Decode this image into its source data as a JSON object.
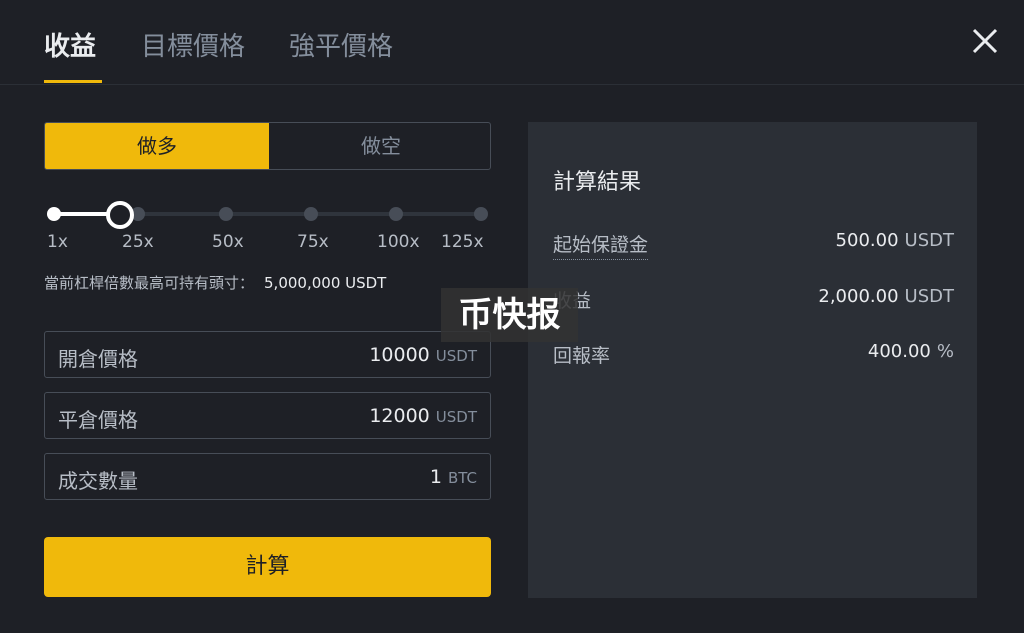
{
  "tabs": [
    {
      "label": "收益",
      "active": true
    },
    {
      "label": "目標價格",
      "active": false
    },
    {
      "label": "強平價格",
      "active": false
    }
  ],
  "side": {
    "long": "做多",
    "short": "做空",
    "selected": "long"
  },
  "leverage": {
    "ticks": [
      "1x",
      "25x",
      "50x",
      "75x",
      "100x",
      "125x"
    ],
    "value": "25x"
  },
  "max_position": {
    "label": "當前杠桿倍數最高可持有頭寸：",
    "value": "5,000,000 USDT"
  },
  "fields": [
    {
      "label": "開倉價格",
      "value": "10000",
      "unit": "USDT"
    },
    {
      "label": "平倉價格",
      "value": "12000",
      "unit": "USDT"
    },
    {
      "label": "成交數量",
      "value": "1",
      "unit": "BTC"
    }
  ],
  "calculate_label": "計算",
  "result": {
    "title": "計算結果",
    "rows": [
      {
        "label": "起始保證金",
        "value": "500.00",
        "unit": "USDT"
      },
      {
        "label": "收益",
        "value": "2,000.00",
        "unit": "USDT"
      },
      {
        "label": "回報率",
        "value": "400.00",
        "unit": "%"
      }
    ]
  },
  "watermark": "币快报",
  "colors": {
    "accent": "#f0b90b",
    "background": "#1e2026",
    "panel": "#2b2f36"
  },
  "icons": {
    "close": "close-icon"
  }
}
